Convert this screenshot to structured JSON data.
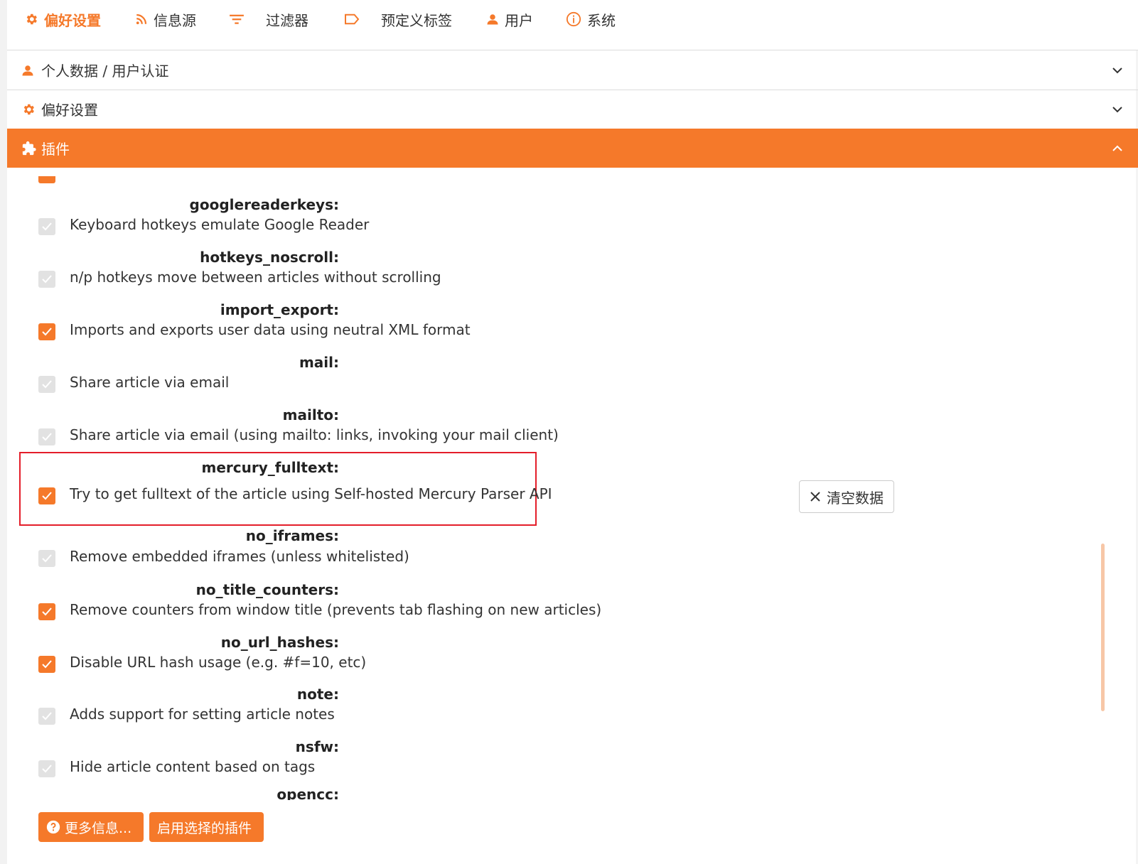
{
  "tabs": [
    {
      "label": "偏好设置",
      "icon": "gear-icon",
      "active": true
    },
    {
      "label": "信息源",
      "icon": "rss-icon"
    },
    {
      "label": "过滤器",
      "icon": "filter-icon"
    },
    {
      "label": "预定义标签",
      "icon": "label-icon"
    },
    {
      "label": "用户",
      "icon": "user-icon"
    },
    {
      "label": "系统",
      "icon": "info-icon"
    }
  ],
  "sections": [
    {
      "label": "个人数据 / 用户认证",
      "icon": "user-icon",
      "expanded": false
    },
    {
      "label": "偏好设置",
      "icon": "gear-icon",
      "expanded": false
    },
    {
      "label": "插件",
      "icon": "puzzle-icon",
      "expanded": true
    }
  ],
  "plugins": [
    {
      "name": "googlereaderkeys:",
      "desc": "Keyboard hotkeys emulate Google Reader",
      "checked": false
    },
    {
      "name": "hotkeys_noscroll:",
      "desc": "n/p hotkeys move between articles without scrolling",
      "checked": false
    },
    {
      "name": "import_export:",
      "desc": "Imports and exports user data using neutral XML format",
      "checked": true
    },
    {
      "name": "mail:",
      "desc": "Share article via email",
      "checked": false
    },
    {
      "name": "mailto:",
      "desc": "Share article via email (using mailto: links, invoking your mail client)",
      "checked": false
    },
    {
      "name": "mercury_fulltext:",
      "desc": "Try to get fulltext of the article using Self-hosted Mercury Parser API",
      "checked": true
    },
    {
      "name": "no_iframes:",
      "desc": "Remove embedded iframes (unless whitelisted)",
      "checked": false
    },
    {
      "name": "no_title_counters:",
      "desc": "Remove counters from window title (prevents tab flashing on new articles)",
      "checked": true
    },
    {
      "name": "no_url_hashes:",
      "desc": "Disable URL hash usage (e.g. #f=10, etc)",
      "checked": true
    },
    {
      "name": "note:",
      "desc": "Adds support for setting article notes",
      "checked": false
    },
    {
      "name": "nsfw:",
      "desc": "Hide article content based on tags",
      "checked": false
    },
    {
      "name": "opencc:",
      "desc": "",
      "checked": false
    }
  ],
  "clear_data_button": "清空数据",
  "footer": {
    "more_info": "更多信息...",
    "enable_selected": "启用选择的插件"
  },
  "colors": {
    "accent": "#f5792a",
    "highlight_border": "#e41e2a"
  }
}
